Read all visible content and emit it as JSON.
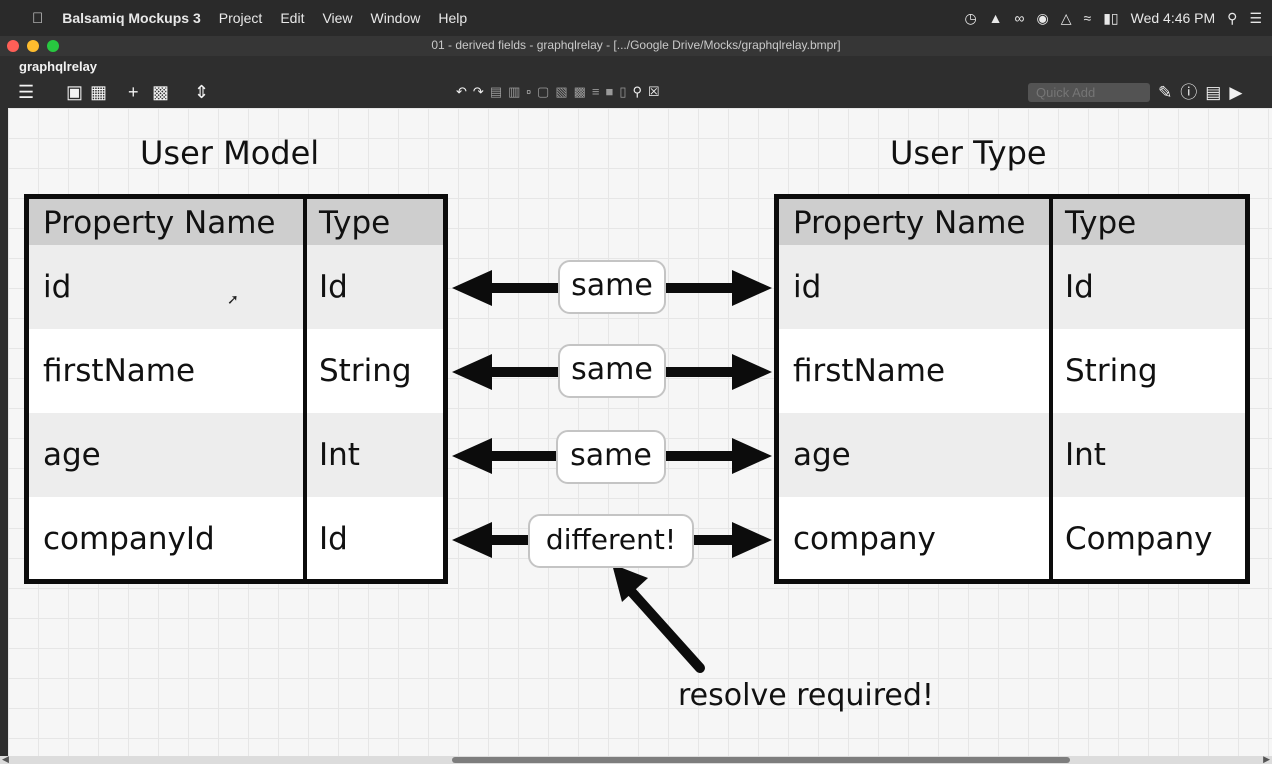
{
  "menubar": {
    "apple": "",
    "items": [
      "Balsamiq Mockups 3",
      "Project",
      "Edit",
      "View",
      "Window",
      "Help"
    ],
    "clock": "Wed 4:46 PM"
  },
  "window": {
    "title": "01 - derived fields - graphqlrelay - [.../Google Drive/Mocks/graphqlrelay.bmpr]"
  },
  "toolbar": {
    "project_name": "graphqlrelay",
    "quick_add_placeholder": "Quick Add"
  },
  "icons": {
    "apple": "apple-icon",
    "time-machine": "time-machine-icon",
    "evernote": "evernote-icon",
    "glasses": "glasses-icon",
    "record": "record-icon",
    "drive": "drive-icon",
    "wifi": "wifi-icon",
    "battery": "battery-icon",
    "spotlight": "spotlight-search-icon",
    "notification-center": "notification-center-icon"
  },
  "mockup": {
    "left_title": "User Model",
    "right_title": "User Type",
    "left_table": {
      "headers": [
        "Property Name",
        "Type"
      ],
      "rows": [
        [
          "id",
          "Id"
        ],
        [
          "firstName",
          "String"
        ],
        [
          "age",
          "Int"
        ],
        [
          "companyId",
          "Id"
        ]
      ]
    },
    "right_table": {
      "headers": [
        "Property Name",
        "Type"
      ],
      "rows": [
        [
          "id",
          "Id"
        ],
        [
          "firstName",
          "String"
        ],
        [
          "age",
          "Int"
        ],
        [
          "company",
          "Company"
        ]
      ]
    },
    "relations": [
      "same",
      "same",
      "same",
      "different!"
    ],
    "note": "resolve required!"
  },
  "colors": {
    "canvas": "#f6f6f6",
    "header_row": "#cecece",
    "alt_row": "#ededed",
    "ink": "#0c0c0c",
    "traffic_red": "#fe5f57",
    "traffic_yellow": "#febc2e",
    "traffic_green": "#28c840"
  }
}
